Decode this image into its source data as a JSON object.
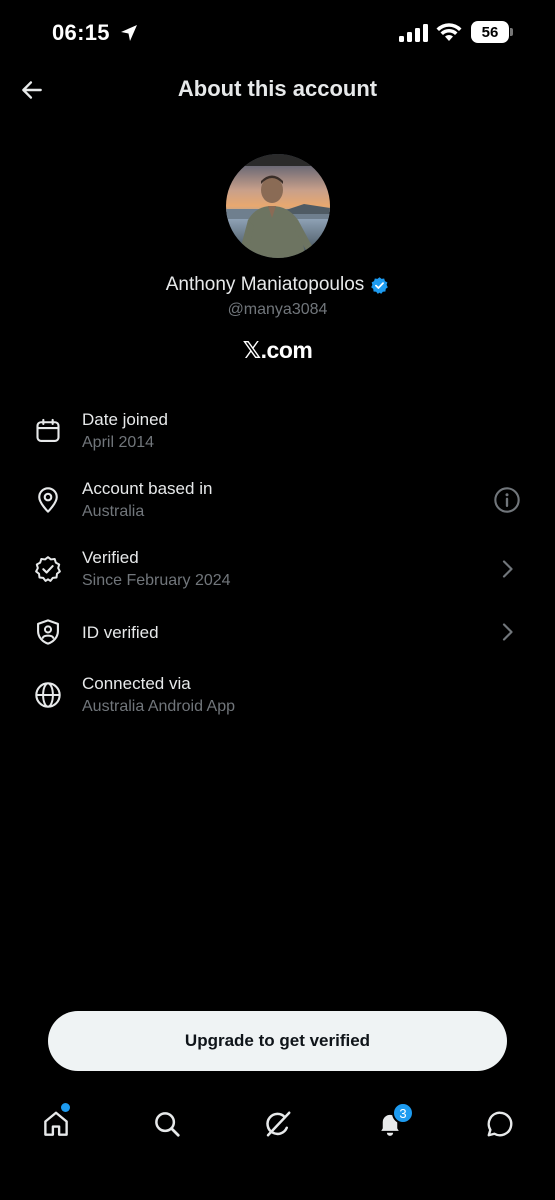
{
  "status_bar": {
    "time": "06:15",
    "battery_level": "56",
    "icons": [
      "location-arrow-icon",
      "cellular-signal-icon",
      "wifi-icon",
      "battery-icon"
    ]
  },
  "header": {
    "title": "About this account",
    "back_icon": "arrow-left-icon"
  },
  "profile": {
    "display_name": "Anthony Maniatopoulos",
    "handle": "@manya3084",
    "site": "𝕏.com",
    "verified_badge_color": "#1d9bf0"
  },
  "info_items": [
    {
      "icon": "calendar-icon",
      "label": "Date joined",
      "value": "April 2014",
      "trailing": ""
    },
    {
      "icon": "location-pin-icon",
      "label": "Account based in",
      "value": "Australia",
      "trailing": "info-icon"
    },
    {
      "icon": "verified-seal-icon",
      "label": "Verified",
      "value": "Since February 2024",
      "trailing": "chevron-right-icon"
    },
    {
      "icon": "id-shield-icon",
      "label": "ID verified",
      "value": "",
      "trailing": "chevron-right-icon"
    },
    {
      "icon": "globe-icon",
      "label": "Connected via",
      "value": "Australia Android App",
      "trailing": ""
    }
  ],
  "upgrade_button": {
    "label": "Upgrade to get verified"
  },
  "bottom_nav": {
    "items": [
      "home-icon",
      "search-icon",
      "grok-icon",
      "notifications-icon",
      "messages-icon"
    ],
    "notifications_count": "3",
    "accent": "#1d9bf0"
  },
  "colors": {
    "background": "#000000",
    "primary_text": "#e7e9ea",
    "secondary_text": "#71767b",
    "accent": "#1d9bf0"
  }
}
